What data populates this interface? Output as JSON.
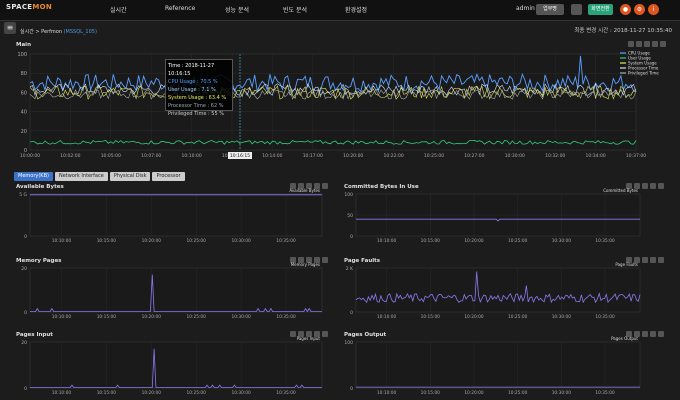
{
  "app": {
    "logo_prefix": "SPACE",
    "logo_suffix": "MON"
  },
  "nav": [
    "실시간",
    "Reference",
    "성능 분석",
    "빈도 분석",
    "환경설정"
  ],
  "header": {
    "user": "admin",
    "btn1": "업무명",
    "btn2": "화면전환"
  },
  "breadcrumb": {
    "prefix": "실시간 > Perfmon ",
    "target": "(MSSQL_105)"
  },
  "updated": "최종 변경 시간 : 2018-11-27 10:35:40",
  "main": {
    "title": "Main",
    "legend": [
      "CPU Usage",
      "User Usage",
      "System Usage",
      "Processor Time",
      "Privileged Time"
    ],
    "xlabels": [
      "10:00:00",
      "10:02:00",
      "10:05:00",
      "10:07:00",
      "10:10:00",
      "10:12:00",
      "10:14:00",
      "10:17:00",
      "10:20:00",
      "10:22:00",
      "10:25:00",
      "10:27:00",
      "10:30:00",
      "10:32:00",
      "10:34:00",
      "10:37:00"
    ],
    "cursor_label": "10:16:15"
  },
  "tooltip": {
    "time": "Time : 2018-11-27 10:16:15",
    "cpu": "CPU Usage : 70.5 %",
    "user": "User Usage : 7.1 %",
    "system": "System Usage : 63.4 %",
    "processor": "Processor Time : 62 %",
    "privileged": "Privileged Time : 55 %"
  },
  "tabs": [
    "Memory(KB)",
    "Network Interface",
    "Physical Disk",
    "Processor"
  ],
  "panels": [
    {
      "title": "Available Bytes",
      "legend": "Available Bytes",
      "y": [
        "5 G",
        "0"
      ]
    },
    {
      "title": "Committed Bytes In Use",
      "legend": "Committed Bytes",
      "y": [
        "100",
        "50",
        "0"
      ]
    },
    {
      "title": "Memory Pages",
      "legend": "Memory Pages",
      "y": [
        "20",
        "0"
      ]
    },
    {
      "title": "Page Faults",
      "legend": "Page Faults",
      "y": [
        "2 K",
        "0"
      ]
    },
    {
      "title": "Pages Input",
      "legend": "Pages Input",
      "y": [
        "20",
        "0"
      ]
    },
    {
      "title": "Pages Output",
      "legend": "Pages Output",
      "y": [
        "100",
        "0"
      ]
    }
  ],
  "panel_xlabels": [
    "10:10:00",
    "10:15:00",
    "10:20:00",
    "10:25:00",
    "10:30:00",
    "10:35:00"
  ],
  "colors": {
    "accent": "#3a73c9",
    "cpu": "#5aa0ff",
    "system": "#e8e85a",
    "low": "#2fd07a",
    "purple": "#8f78f0"
  }
}
